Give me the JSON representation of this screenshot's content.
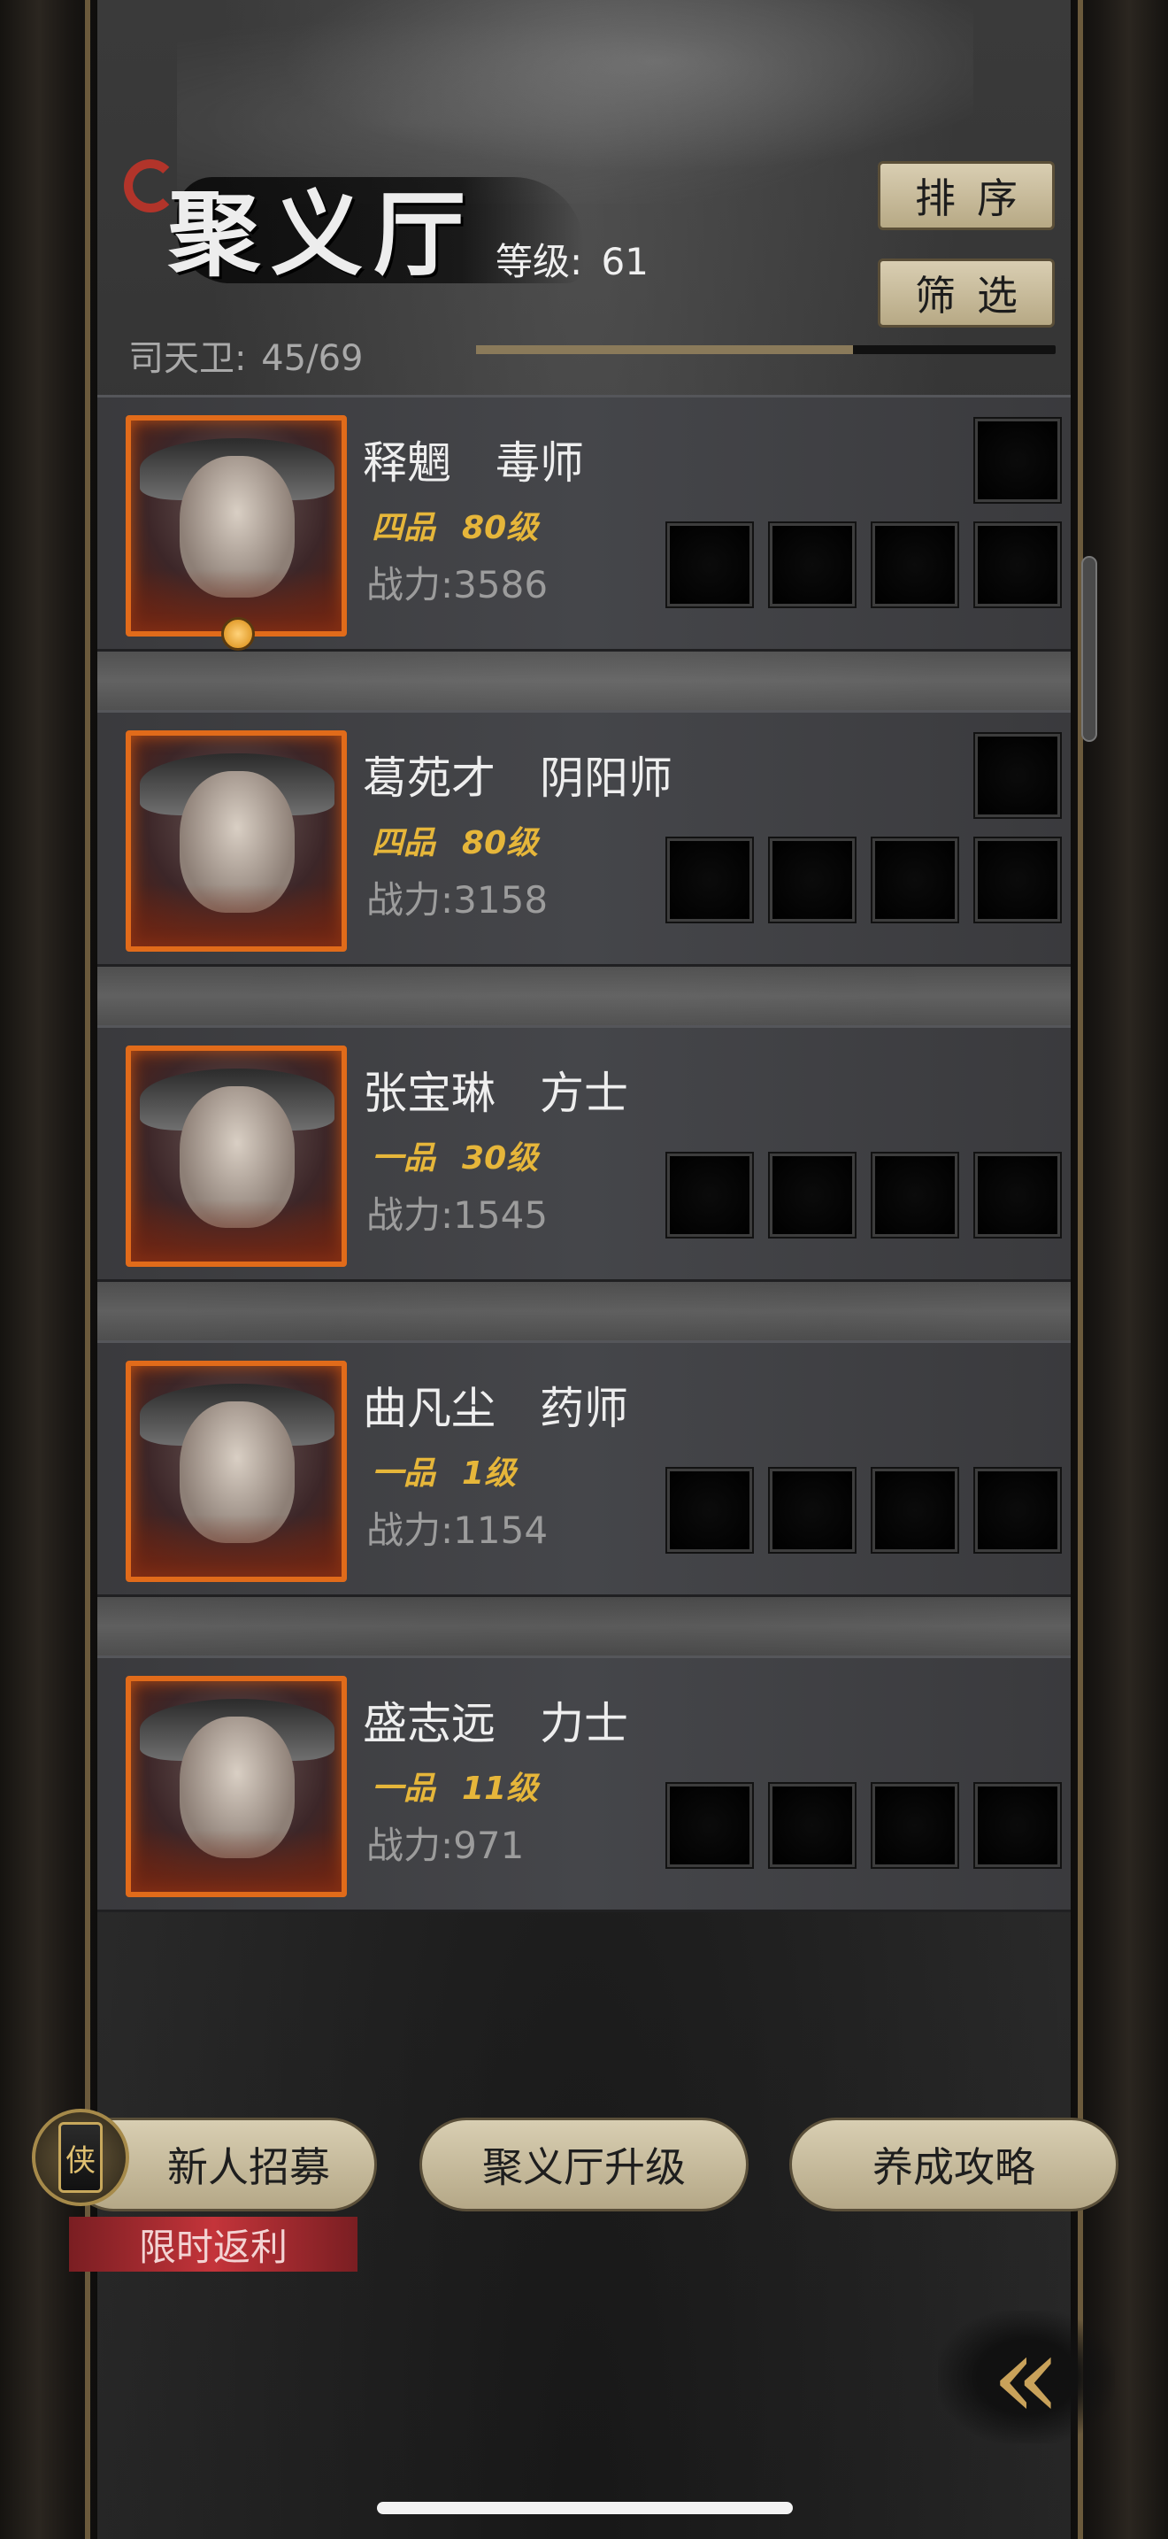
{
  "header": {
    "title": "聚义厅",
    "level_label": "等级:",
    "level_value": "61",
    "guard_label": "司天卫:",
    "guard_value": "45/69",
    "guard_progress": 0.65
  },
  "actions": {
    "sort_label": "排序",
    "filter_label": "筛选"
  },
  "heroes": [
    {
      "name": "释魍",
      "role": "毒师",
      "rank": "四品",
      "level": "80级",
      "power_label": "战力:",
      "power": "3586"
    },
    {
      "name": "葛苑才",
      "role": "阴阳师",
      "rank": "四品",
      "level": "80级",
      "power_label": "战力:",
      "power": "3158"
    },
    {
      "name": "张宝琳",
      "role": "方士",
      "rank": "一品",
      "level": "30级",
      "power_label": "战力:",
      "power": "1545"
    },
    {
      "name": "曲凡尘",
      "role": "药师",
      "rank": "一品",
      "level": "1级",
      "power_label": "战力:",
      "power": "1154"
    },
    {
      "name": "盛志远",
      "role": "力士",
      "rank": "一品",
      "level": "11级",
      "power_label": "战力:",
      "power": "971"
    }
  ],
  "bottom": {
    "recruit_label": "新人招募",
    "recruit_emblem": "侠",
    "promo_label": "限时返利",
    "upgrade_label": "聚义厅升级",
    "guide_label": "养成攻略",
    "back_icon": "«"
  },
  "colors": {
    "accent_gold": "#e6b63a",
    "portrait_border": "#e16b1a",
    "promo_red": "#c4343a"
  }
}
